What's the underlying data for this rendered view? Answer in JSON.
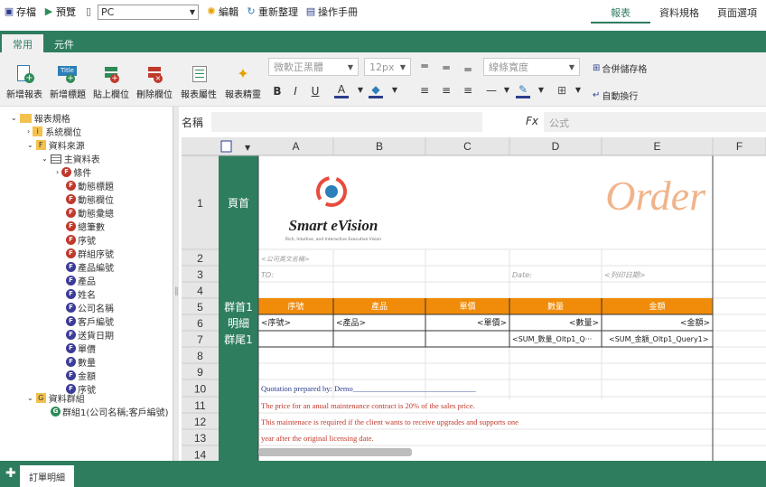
{
  "topbar": {
    "save": "存檔",
    "preview": "預覽",
    "device": "PC",
    "edit": "編輯",
    "refresh": "重新整理",
    "manual": "操作手冊"
  },
  "toptabs": [
    "報表",
    "資料規格",
    "頁面選項"
  ],
  "ribbon_tabs": [
    "常用",
    "元件"
  ],
  "ribbon": {
    "buttons": [
      "新增報表",
      "新增標題",
      "貼上欄位",
      "刪除欄位",
      "報表屬性",
      "報表精靈"
    ],
    "font_family": "微軟正黑體",
    "font_size": "12px",
    "line_width": "線條寬度",
    "merge_cells": "合併儲存格",
    "wrap_text": "自動換行",
    "bold": "B",
    "italic": "I",
    "underline": "U",
    "font_color_letter": "A",
    "title_icon_text": "Title"
  },
  "tree": {
    "root": "報表規格",
    "system_fields": "系統欄位",
    "data_source": "資料來源",
    "main_table": "主資料表",
    "items": [
      {
        "badge": "F",
        "label": "條件",
        "color": "#c0392b",
        "expander": true
      },
      {
        "badge": "F",
        "label": "動態標題",
        "color": "#c0392b"
      },
      {
        "badge": "F",
        "label": "動態欄位",
        "color": "#c0392b"
      },
      {
        "badge": "F",
        "label": "動態彙總",
        "color": "#c0392b"
      },
      {
        "badge": "F",
        "label": "總筆數",
        "color": "#c0392b"
      },
      {
        "badge": "F",
        "label": "序號",
        "color": "#c0392b"
      },
      {
        "badge": "F",
        "label": "群組序號",
        "color": "#c0392b"
      },
      {
        "badge": "F",
        "label": "產品編號",
        "color": "#3b3b98"
      },
      {
        "badge": "F",
        "label": "產品",
        "color": "#3b3b98"
      },
      {
        "badge": "F",
        "label": "姓名",
        "color": "#3b3b98"
      },
      {
        "badge": "F",
        "label": "公司名稱",
        "color": "#3b3b98"
      },
      {
        "badge": "F",
        "label": "客戶編號",
        "color": "#3b3b98"
      },
      {
        "badge": "F",
        "label": "送貨日期",
        "color": "#3b3b98"
      },
      {
        "badge": "F",
        "label": "單價",
        "color": "#3b3b98"
      },
      {
        "badge": "F",
        "label": "數量",
        "color": "#3b3b98"
      },
      {
        "badge": "F",
        "label": "金額",
        "color": "#3b3b98"
      },
      {
        "badge": "F",
        "label": "序號",
        "color": "#3b3b98"
      }
    ],
    "data_group": "資料群組",
    "group1": "群組1(公司名稱;客戶編號)",
    "badge_i": "i",
    "badge_f": "F",
    "badge_g": "G"
  },
  "formula": {
    "name_label": "名稱",
    "fx_label": "Fx",
    "fx_placeholder": "公式"
  },
  "grid": {
    "columns": [
      "A",
      "B",
      "C",
      "D",
      "E",
      "F"
    ],
    "rows": [
      "1",
      "2",
      "3",
      "4",
      "5",
      "6",
      "7",
      "8",
      "9",
      "10",
      "11",
      "12",
      "13",
      "14"
    ],
    "sections": [
      "頁首",
      "群首1",
      "明細",
      "群尾1"
    ],
    "logo_main": "Smart eVision",
    "logo_sub": "Rich, Intuitive, and Interactive Executive Vision",
    "order_title": "Order",
    "company_en": "<公司英文名稱>",
    "to_label": "TO:",
    "date_label": "Date:",
    "print_date": "<列印日期>",
    "headers": [
      "序號",
      "產品",
      "單價",
      "數量",
      "金額"
    ],
    "detail": [
      "<序號>",
      "<產品>",
      "<單價>",
      "<數量>",
      "<金額>"
    ],
    "sum_qty": "<SUM_數量_Oltp1_Q···",
    "sum_amt": "<SUM_金額_Oltp1_Query1>",
    "r10": "Quotation prepared by: Demo________________________________",
    "r11": "The price for an anual maintenance contract is 20% of the sales price.",
    "r12": "This maintenace is required if the client wants to receive upgrades and supports one",
    "r13": "year after the original licensing date."
  },
  "sheet_tab": "訂單明細",
  "colors": {
    "brand": "#2e7d5f",
    "header_orange": "#f08c0a",
    "order_peach": "#f0b48c",
    "red_text": "#c0392b"
  }
}
